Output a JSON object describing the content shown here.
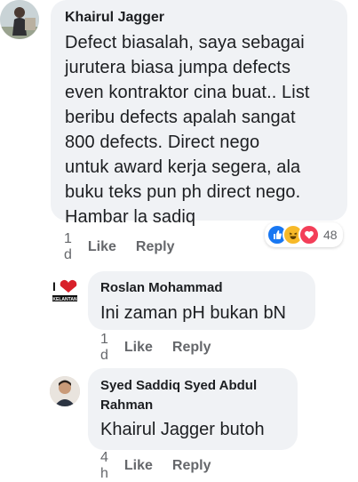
{
  "comments": [
    {
      "author": "Khairul Jagger",
      "text": "Defect biasalah, saya sebagai\njurutera biasa jumpa defects\neven kontraktor cina buat.. List\nberibu defects apalah sangat\n800 defects. Direct nego\nuntuk award kerja segera, ala\nbuku teks pun ph direct nego.\nHambar la sadiq",
      "time": "1 d",
      "like_label": "Like",
      "reply_label": "Reply",
      "reactions": {
        "icons": [
          "like-icon",
          "haha-icon",
          "love-icon"
        ],
        "count": "48",
        "colors": {
          "like": "#1877f2",
          "haha": "#f7b928",
          "love": "#f33e58"
        }
      }
    },
    {
      "author": "Roslan Mohammad",
      "text": "Ini zaman pH bukan bN",
      "time": "1 d",
      "like_label": "Like",
      "reply_label": "Reply",
      "avatar_logo": "I ❤ KELANTAN"
    },
    {
      "author": "Syed Saddiq Syed Abdul\nRahman",
      "text": "Khairul Jagger butoh",
      "time": "4 h",
      "like_label": "Like",
      "reply_label": "Reply"
    }
  ]
}
